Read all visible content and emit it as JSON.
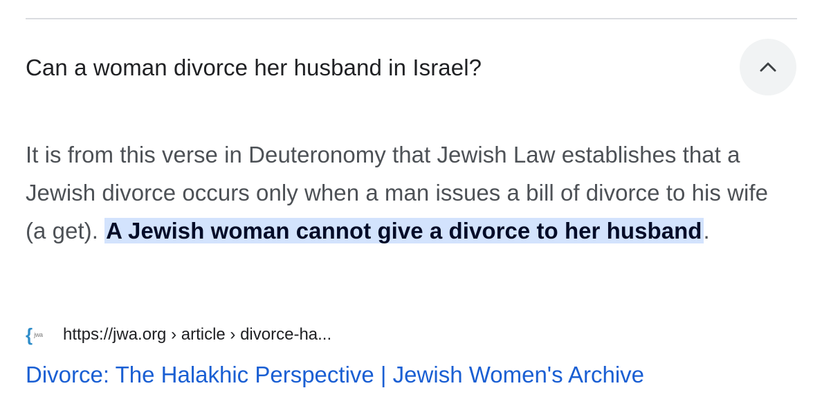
{
  "question": "Can a woman divorce her husband in Israel?",
  "toggle_icon": "chevron-up-icon",
  "answer": {
    "text_before": "It is from this verse in Deuteronomy that Jewish Law establishes that a Jewish divorce occurs only when a man issues a bill of divorce to his wife (a get). ",
    "highlight": "A Jewish woman cannot give a divorce to her husband",
    "text_after": "."
  },
  "source": {
    "favicon_brace": "{",
    "favicon_text": "jwa",
    "url": "https://jwa.org › article › divorce-ha...",
    "title": "Divorce: The Halakhic Perspective | Jewish Women's Archive"
  },
  "colors": {
    "highlight_bg": "#d3e3fd",
    "link": "#1a5fd3",
    "body_text": "#4d5156"
  }
}
